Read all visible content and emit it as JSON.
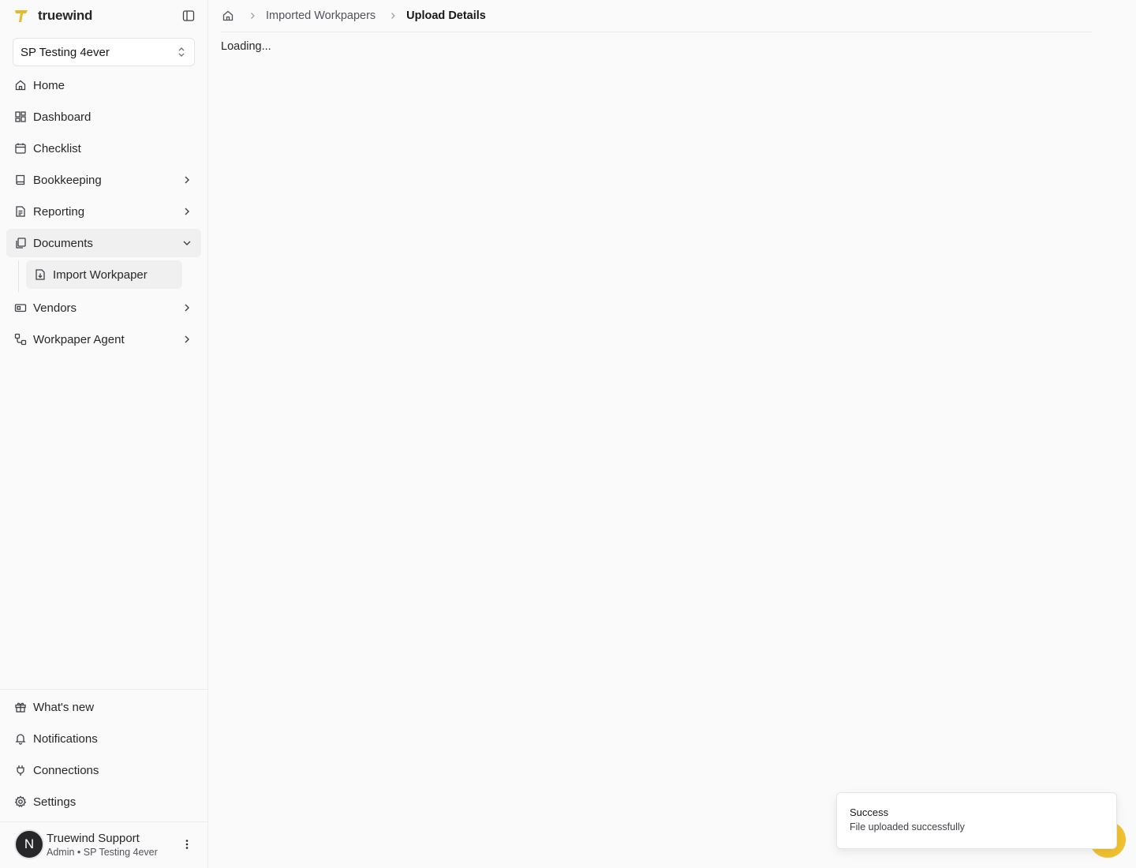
{
  "app": {
    "name": "truewind",
    "accent": "#e9b824"
  },
  "org_selector": {
    "value": "SP Testing 4ever"
  },
  "nav": {
    "items": [
      {
        "label": "Home",
        "icon": "home-icon"
      },
      {
        "label": "Dashboard",
        "icon": "dashboard-icon"
      },
      {
        "label": "Checklist",
        "icon": "calendar-icon"
      },
      {
        "label": "Bookkeeping",
        "icon": "book-icon"
      },
      {
        "label": "Reporting",
        "icon": "file-text-icon"
      },
      {
        "label": "Documents",
        "icon": "files-icon"
      },
      {
        "label": "Vendors",
        "icon": "id-card-icon"
      },
      {
        "label": "Workpaper Agent",
        "icon": "workflow-icon"
      }
    ],
    "documents_sub": {
      "label": "Import Workpaper",
      "icon": "file-import-icon"
    }
  },
  "bottom_nav": [
    {
      "label": "What's new",
      "icon": "gift-icon"
    },
    {
      "label": "Notifications",
      "icon": "bell-icon"
    },
    {
      "label": "Connections",
      "icon": "plug-icon"
    },
    {
      "label": "Settings",
      "icon": "gear-icon"
    }
  ],
  "user": {
    "initial": "N",
    "name": "Truewind Support",
    "subtitle": "Admin • SP Testing 4ever"
  },
  "breadcrumb": {
    "parent": "Imported Workpapers",
    "current": "Upload Details"
  },
  "main": {
    "loading_text": "Loading..."
  },
  "toast": {
    "title": "Success",
    "description": "File uploaded successfully"
  }
}
